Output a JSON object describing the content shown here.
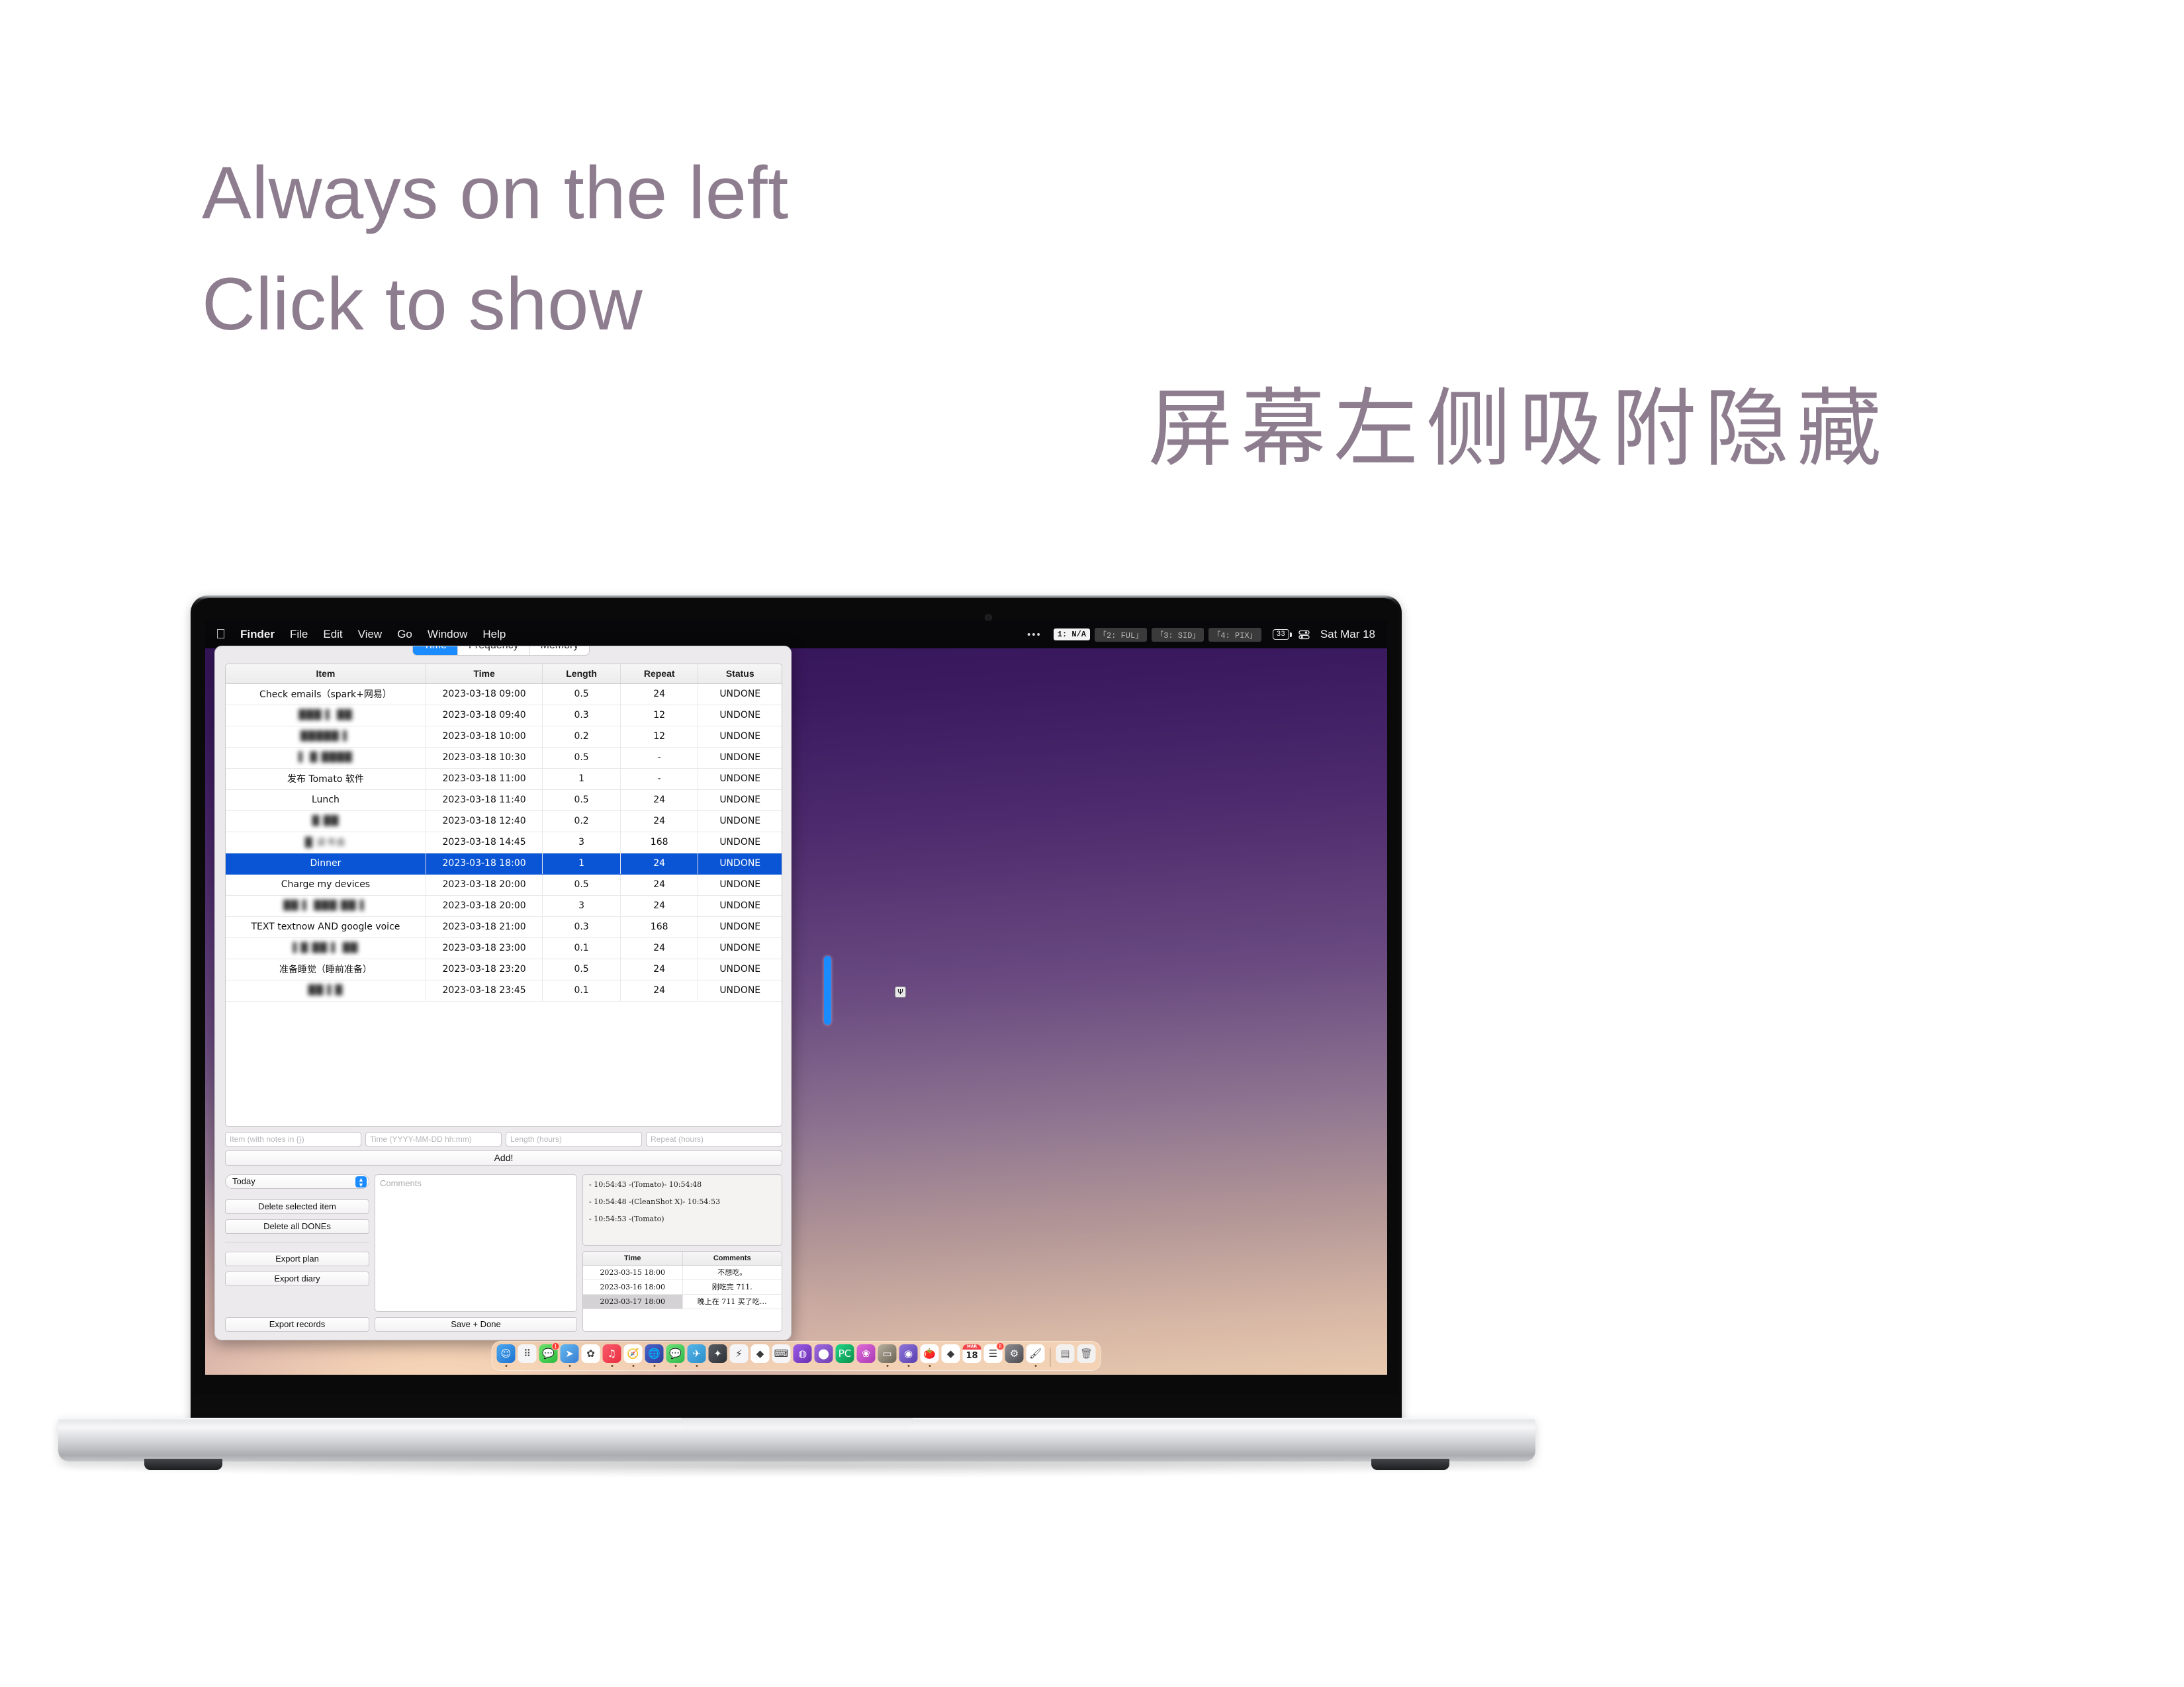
{
  "headline": {
    "line1": "Always on the left",
    "line2": "Click to show",
    "chinese": "屏幕左侧吸附隐藏",
    "color": "#8d7d8f"
  },
  "menubar": {
    "apple_glyph": "",
    "items": [
      "Finder",
      "File",
      "Edit",
      "View",
      "Go",
      "Window",
      "Help"
    ],
    "dots": "•••",
    "workspaces": [
      {
        "label": "1: N/A",
        "active": true
      },
      {
        "label": "「2: FUL」",
        "active": false
      },
      {
        "label": "「3: SID」",
        "active": false
      },
      {
        "label": "「4: PIX」",
        "active": false
      }
    ],
    "battery": "33",
    "clock": "Sat Mar 18"
  },
  "desktop": {
    "file_icon_glyph": "Ψ"
  },
  "app": {
    "tabs": [
      {
        "label": "Time",
        "active": true
      },
      {
        "label": "Frequency",
        "active": false
      },
      {
        "label": "Memory",
        "active": false
      }
    ],
    "table": {
      "columns": [
        "Item",
        "Time",
        "Length",
        "Repeat",
        "Status"
      ],
      "rows": [
        {
          "item": "Check emails（spark+网易）",
          "blurred": false,
          "time": "2023-03-18 09:00",
          "length": "0.5",
          "repeat": "24",
          "status": "UNDONE",
          "selected": false
        },
        {
          "item": "███ ▌ ██",
          "blurred": true,
          "time": "2023-03-18 09:40",
          "length": "0.3",
          "repeat": "12",
          "status": "UNDONE",
          "selected": false
        },
        {
          "item": "█████ ▌",
          "blurred": true,
          "time": "2023-03-18 10:00",
          "length": "0.2",
          "repeat": "12",
          "status": "UNDONE",
          "selected": false
        },
        {
          "item": "▌ █ ████",
          "blurred": true,
          "time": "2023-03-18 10:30",
          "length": "0.5",
          "repeat": "-",
          "status": "UNDONE",
          "selected": false
        },
        {
          "item": "发布 Tomato 软件",
          "blurred": false,
          "time": "2023-03-18 11:00",
          "length": "1",
          "repeat": "-",
          "status": "UNDONE",
          "selected": false
        },
        {
          "item": "Lunch",
          "blurred": false,
          "time": "2023-03-18 11:40",
          "length": "0.5",
          "repeat": "24",
          "status": "UNDONE",
          "selected": false
        },
        {
          "item": "█ ██",
          "blurred": true,
          "time": "2023-03-18 12:40",
          "length": "0.2",
          "repeat": "24",
          "status": "UNDONE",
          "selected": false
        },
        {
          "item": "█ 读书会",
          "blurred": true,
          "time": "2023-03-18 14:45",
          "length": "3",
          "repeat": "168",
          "status": "UNDONE",
          "selected": false
        },
        {
          "item": "Dinner",
          "blurred": false,
          "time": "2023-03-18 18:00",
          "length": "1",
          "repeat": "24",
          "status": "UNDONE",
          "selected": true
        },
        {
          "item": "Charge my devices",
          "blurred": false,
          "time": "2023-03-18 20:00",
          "length": "0.5",
          "repeat": "24",
          "status": "UNDONE",
          "selected": false
        },
        {
          "item": "██ ▌ ███ ██ ▌",
          "blurred": true,
          "time": "2023-03-18 20:00",
          "length": "3",
          "repeat": "24",
          "status": "UNDONE",
          "selected": false
        },
        {
          "item": "TEXT textnow AND google voice",
          "blurred": false,
          "time": "2023-03-18 21:00",
          "length": "0.3",
          "repeat": "168",
          "status": "UNDONE",
          "selected": false
        },
        {
          "item": "▌█ ██ ▌ ██",
          "blurred": true,
          "time": "2023-03-18 23:00",
          "length": "0.1",
          "repeat": "24",
          "status": "UNDONE",
          "selected": false
        },
        {
          "item": "准备睡觉（睡前准备）",
          "blurred": false,
          "time": "2023-03-18 23:20",
          "length": "0.5",
          "repeat": "24",
          "status": "UNDONE",
          "selected": false
        },
        {
          "item": "██ ▌█",
          "blurred": true,
          "time": "2023-03-18 23:45",
          "length": "0.1",
          "repeat": "24",
          "status": "UNDONE",
          "selected": false
        }
      ]
    },
    "inputs": {
      "item_placeholder": "Item (with notes in {})",
      "time_placeholder": "Time (YYYY-MM-DD hh:mm)",
      "length_placeholder": "Length (hours)",
      "repeat_placeholder": "Repeat (hours)",
      "item_value": "",
      "time_value": "",
      "length_value": "",
      "repeat_value": ""
    },
    "add_button": "Add!",
    "range_popup": "Today",
    "buttons": {
      "delete_selected": "Delete selected item",
      "delete_dones": "Delete all DONEs",
      "export_plan": "Export plan",
      "export_diary": "Export diary",
      "export_records": "Export records",
      "save_done": "Save + Done"
    },
    "comments_placeholder": "Comments",
    "comments_value": "",
    "log_lines": [
      "- 10:54:43 -(Tomato)- 10:54:48",
      "- 10:54:48 -(CleanShot X)- 10:54:53",
      "- 10:54:53 -(Tomato)"
    ],
    "diary": {
      "columns": [
        "Time",
        "Comments"
      ],
      "rows": [
        {
          "time": "2023-03-15 18:00",
          "comment": "不想吃。",
          "highlight": false
        },
        {
          "time": "2023-03-16 18:00",
          "comment": "刚吃完 711.",
          "highlight": false
        },
        {
          "time": "2023-03-17 18:00",
          "comment": "晚上在 711 买了吃…",
          "highlight": true
        }
      ]
    }
  },
  "dock": {
    "items": [
      {
        "name": "finder",
        "glyph": "☺",
        "bg": "linear-gradient(135deg,#4aa8f0,#1e72d0)",
        "running": true,
        "badge": ""
      },
      {
        "name": "launchpad",
        "glyph": "⠿",
        "bg": "#f5f5f7",
        "running": false,
        "badge": ""
      },
      {
        "name": "messages",
        "glyph": "💬",
        "bg": "linear-gradient(135deg,#6ce26c,#2bbb3e)",
        "running": false,
        "badge": "1"
      },
      {
        "name": "spark-mail",
        "glyph": "➤",
        "bg": "linear-gradient(135deg,#62b8ef,#3a7fd5)",
        "running": true,
        "badge": ""
      },
      {
        "name": "photos",
        "glyph": "✿",
        "bg": "#ffffff",
        "running": false,
        "badge": ""
      },
      {
        "name": "music",
        "glyph": "♫",
        "bg": "linear-gradient(135deg,#fa5b6d,#e8303f)",
        "running": true,
        "badge": ""
      },
      {
        "name": "safari",
        "glyph": "🧭",
        "bg": "#ffffff",
        "running": true,
        "badge": ""
      },
      {
        "name": "browser",
        "glyph": "🌐",
        "bg": "linear-gradient(135deg,#4a63c8,#2b3f9e)",
        "running": true,
        "badge": ""
      },
      {
        "name": "wechat",
        "glyph": "💬",
        "bg": "linear-gradient(135deg,#6ee07a,#2fb94a)",
        "running": true,
        "badge": ""
      },
      {
        "name": "telegram",
        "glyph": "✈",
        "bg": "linear-gradient(135deg,#56b6e8,#2a8ecb)",
        "running": true,
        "badge": ""
      },
      {
        "name": "cleanshot",
        "glyph": "✦",
        "bg": "linear-gradient(135deg,#5a5f66,#2d3136)",
        "running": false,
        "badge": ""
      },
      {
        "name": "notes-fast",
        "glyph": "⚡",
        "bg": "#f5f5f7",
        "running": false,
        "badge": ""
      },
      {
        "name": "obsidian",
        "glyph": "◆",
        "bg": "#ffffff",
        "running": false,
        "badge": ""
      },
      {
        "name": "keyboard",
        "glyph": "⌨",
        "bg": "#f5f5f7",
        "running": false,
        "badge": ""
      },
      {
        "name": "viber",
        "glyph": "◍",
        "bg": "linear-gradient(135deg,#9b5de5,#6a2fb5)",
        "running": false,
        "badge": ""
      },
      {
        "name": "github",
        "glyph": "⬤",
        "bg": "linear-gradient(135deg,#a06ce0,#6f3fb0)",
        "running": false,
        "badge": ""
      },
      {
        "name": "pycharm",
        "glyph": "PC",
        "bg": "linear-gradient(135deg,#21d789,#0b8f4a)",
        "running": false,
        "badge": ""
      },
      {
        "name": "flower-app",
        "glyph": "❀",
        "bg": "linear-gradient(135deg,#e06bd8,#a93bb5)",
        "running": false,
        "badge": ""
      },
      {
        "name": "retro-tv",
        "glyph": "▭",
        "bg": "linear-gradient(135deg,#b8b0a0,#6a6455)",
        "running": true,
        "badge": ""
      },
      {
        "name": "openai",
        "glyph": "◉",
        "bg": "linear-gradient(135deg,#8f76d8,#5a3fb0)",
        "running": true,
        "badge": ""
      },
      {
        "name": "tomato",
        "glyph": "🍅",
        "bg": "#ffffff",
        "running": true,
        "badge": ""
      },
      {
        "name": "ruby-gem",
        "glyph": "◆",
        "bg": "#ffffff",
        "running": false,
        "badge": ""
      },
      {
        "name": "calendar",
        "glyph": "18",
        "bg": "#ffffff",
        "running": false,
        "badge": ""
      },
      {
        "name": "reminders",
        "glyph": "☰",
        "bg": "#ffffff",
        "running": false,
        "badge": "8"
      },
      {
        "name": "system-settings",
        "glyph": "⚙",
        "bg": "linear-gradient(135deg,#8e8e93,#4a4a50)",
        "running": false,
        "badge": ""
      },
      {
        "name": "preview-paint",
        "glyph": "🖌",
        "bg": "#ffffff",
        "running": true,
        "badge": ""
      }
    ],
    "calendar_month": "MAR",
    "downloads_name": "downloads-stack",
    "trash_name": "trash"
  }
}
